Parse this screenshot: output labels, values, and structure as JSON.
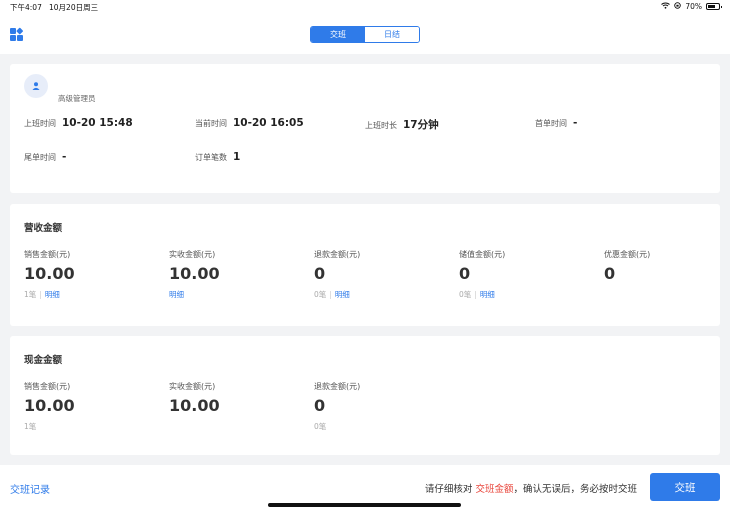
{
  "status_bar": {
    "time": "下午4:07",
    "date": "10月20日周三",
    "battery": "70%",
    "battery_level": 0.7
  },
  "header": {
    "tabs": [
      {
        "label": "交班",
        "active": true
      },
      {
        "label": "日结",
        "active": false
      }
    ]
  },
  "user": {
    "name": "",
    "role": "高级管理员"
  },
  "shift_info": {
    "start_time": {
      "label": "上班时间",
      "value": "10-20 15:48"
    },
    "current_time": {
      "label": "当前时间",
      "value": "10-20 16:05"
    },
    "duration": {
      "label": "上班时长",
      "value": "17分钟"
    },
    "first_order": {
      "label": "首单时间",
      "value": "-"
    },
    "last_order": {
      "label": "尾单时间",
      "value": "-"
    },
    "order_count": {
      "label": "订单笔数",
      "value": "1"
    }
  },
  "revenue": {
    "title": "营收金额",
    "metrics": [
      {
        "label": "销售金额(元)",
        "value": "10.00",
        "count": "1笔",
        "link": "明细"
      },
      {
        "label": "实收金额(元)",
        "value": "10.00",
        "count": "",
        "link": "明细"
      },
      {
        "label": "退款金额(元)",
        "value": "0",
        "count": "0笔",
        "link": "明细"
      },
      {
        "label": "储值金额(元)",
        "value": "0",
        "count": "0笔",
        "link": "明细"
      },
      {
        "label": "优惠金额(元)",
        "value": "0",
        "count": "",
        "link": ""
      }
    ]
  },
  "cash": {
    "title": "现金金额",
    "metrics": [
      {
        "label": "销售金额(元)",
        "value": "10.00",
        "count": "1笔"
      },
      {
        "label": "实收金额(元)",
        "value": "10.00",
        "count": ""
      },
      {
        "label": "退款金额(元)",
        "value": "0",
        "count": "0笔"
      }
    ]
  },
  "footer": {
    "history_link": "交班记录",
    "notice_pre": "请仔细核对",
    "notice_highlight": "交班金额",
    "notice_post": "，确认无误后，务必按时交班",
    "submit_label": "交班"
  },
  "colors": {
    "accent": "#2f7be9",
    "highlight": "#e8443a"
  }
}
